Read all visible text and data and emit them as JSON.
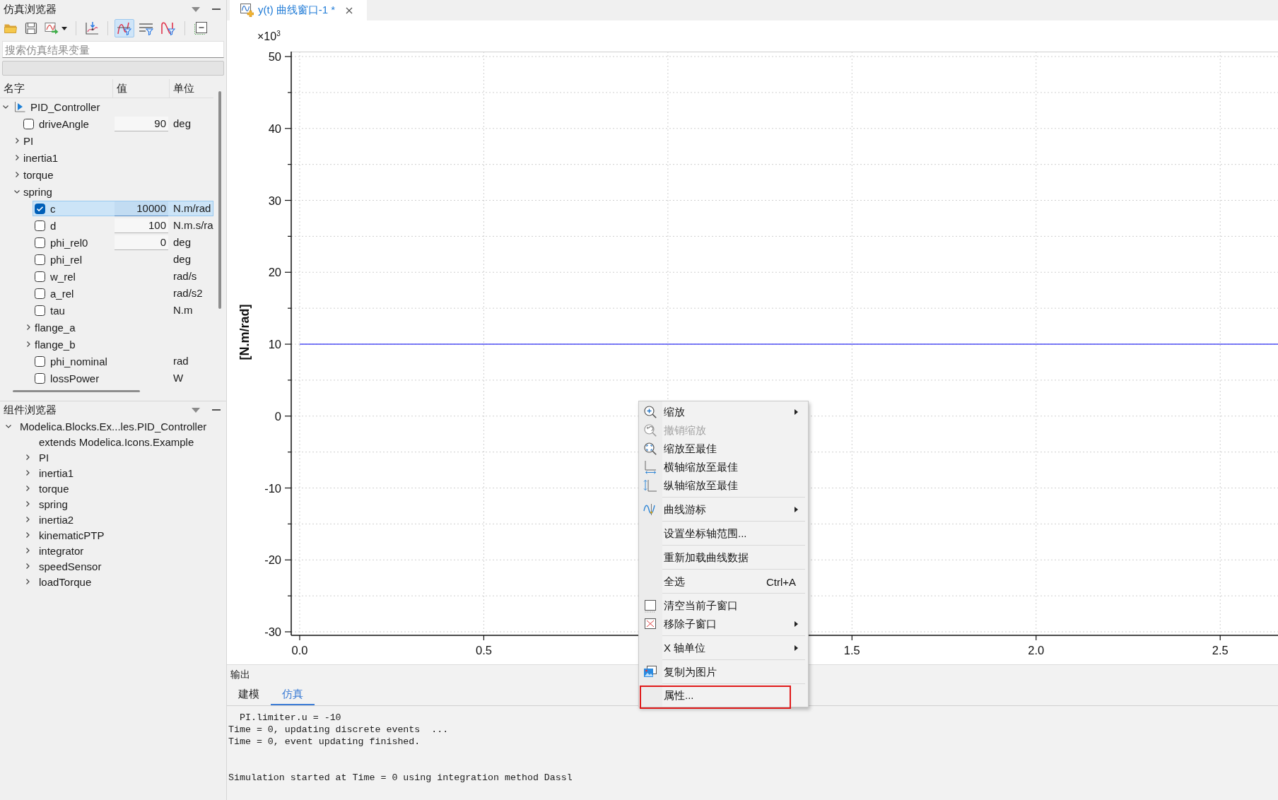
{
  "simulation_browser": {
    "title": "仿真浏览器",
    "toolbar": [
      [
        {
          "on": false
        },
        {
          "on": false
        },
        {
          "on": false
        }
      ],
      [
        {
          "on": false
        }
      ],
      [
        {
          "on": true
        },
        {
          "on": false
        },
        {
          "on": false
        }
      ],
      [
        {
          "on": false
        }
      ]
    ],
    "search": {
      "placeholder": "搜索仿真结果变量"
    },
    "columns": [
      "名字",
      "值",
      "单位"
    ],
    "tree": [
      {
        "kind": "model",
        "label": "PID_Controller",
        "expanded": true,
        "selected": false,
        "children": [
          {
            "kind": "parameter",
            "label": "driveAngle",
            "value": "90",
            "unit": "deg",
            "checked": false,
            "selected": false
          },
          {
            "kind": "group",
            "label": "PI",
            "expanded": false,
            "selected": false
          },
          {
            "kind": "group",
            "label": "inertia1",
            "expanded": false,
            "selected": false
          },
          {
            "kind": "group",
            "label": "torque",
            "expanded": false,
            "selected": false
          },
          {
            "kind": "group",
            "label": "spring",
            "expanded": true,
            "selected": false,
            "children": [
              {
                "kind": "parameter",
                "label": "c",
                "value": "10000",
                "unit": "N.m/rad",
                "checked": true,
                "selected": true
              },
              {
                "kind": "parameter",
                "label": "d",
                "value": "100",
                "unit": "N.m.s/ra",
                "checked": false,
                "selected": false
              },
              {
                "kind": "parameter",
                "label": "phi_rel0",
                "value": "0",
                "unit": "deg",
                "checked": false,
                "selected": false
              },
              {
                "kind": "variable",
                "label": "phi_rel",
                "unit": "deg",
                "checked": false,
                "selected": false
              },
              {
                "kind": "variable",
                "label": "w_rel",
                "unit": "rad/s",
                "checked": false,
                "selected": false
              },
              {
                "kind": "variable",
                "label": "a_rel",
                "unit": "rad/s2",
                "checked": false,
                "selected": false
              },
              {
                "kind": "variable",
                "label": "tau",
                "unit": "N.m",
                "checked": false,
                "selected": false
              },
              {
                "kind": "group",
                "label": "flange_a",
                "expanded": false,
                "selected": false
              },
              {
                "kind": "group",
                "label": "flange_b",
                "expanded": false,
                "selected": false
              },
              {
                "kind": "variable",
                "label": "phi_nominal",
                "unit": "rad",
                "checked": false,
                "selected": false
              },
              {
                "kind": "variable",
                "label": "lossPower",
                "unit": "W",
                "checked": false,
                "selected": false
              }
            ]
          }
        ]
      }
    ]
  },
  "component_browser": {
    "title": "组件浏览器",
    "tree": [
      {
        "kind": "model",
        "label": "Modelica.Blocks.Ex...les.PID_Controller",
        "expanded": true,
        "selected": false,
        "children": [
          {
            "kind": "extends",
            "label": "extends Modelica.Icons.Example",
            "selected": false
          },
          {
            "kind": "component",
            "label": "PI",
            "expanded": false,
            "selected": false
          },
          {
            "kind": "component",
            "label": "inertia1",
            "expanded": false,
            "selected": false
          },
          {
            "kind": "component",
            "label": "torque",
            "expanded": false,
            "selected": false
          },
          {
            "kind": "component",
            "label": "spring",
            "expanded": false,
            "selected": false
          },
          {
            "kind": "component",
            "label": "inertia2",
            "expanded": false,
            "selected": false
          },
          {
            "kind": "component",
            "label": "kinematicPTP",
            "expanded": false,
            "selected": false
          },
          {
            "kind": "component",
            "label": "integrator",
            "expanded": false,
            "selected": false
          },
          {
            "kind": "component",
            "label": "speedSensor",
            "expanded": false,
            "selected": false
          },
          {
            "kind": "component",
            "label": "loadTorque",
            "expanded": false,
            "selected": false
          }
        ]
      }
    ]
  },
  "document_tabs": [
    {
      "label": "y(t) 曲线窗口-1 *",
      "selected": true
    }
  ],
  "plot": {
    "scale_label": "×10$^{3}$",
    "chart_data": {
      "type": "line",
      "ylabel": "[N.m/rad]",
      "x": [
        0,
        2.657
      ],
      "series": [
        {
          "color": "#4f4ff5",
          "values": [
            10,
            10
          ]
        }
      ],
      "xlim": [
        -0.023,
        2.657
      ],
      "ylim": [
        -30.49,
        50.69
      ],
      "xticks": [
        {
          "value": 0,
          "label": "0.0"
        },
        {
          "value": 0.5,
          "label": "0.5"
        },
        {
          "value": 1.5,
          "label": "1.5"
        },
        {
          "value": 2,
          "label": "2.0"
        },
        {
          "value": 2.5,
          "label": "2.5"
        }
      ],
      "yticks": [
        50,
        40,
        30,
        20,
        10,
        0,
        -10,
        -20,
        -30
      ],
      "grid": true
    }
  },
  "output": {
    "title": "输出",
    "tabs": [
      {
        "label": "建模",
        "selected": false
      },
      {
        "label": "仿真",
        "selected": true
      }
    ],
    "log_blocks": [
      [
        "  PI.limiter.u = -10",
        "Time = 0, updating discrete events  ...",
        "Time = 0, event updating finished."
      ],
      [
        "Simulation started at Time = 0 using integration method Dassl"
      ]
    ]
  },
  "context_menu": {
    "sections": [
      [
        {
          "label": "缩放",
          "disabled": false,
          "submenu": true,
          "highlighted": false
        },
        {
          "label": "撤销缩放",
          "disabled": true,
          "submenu": false,
          "highlighted": false
        },
        {
          "label": "缩放至最佳",
          "disabled": false,
          "submenu": false,
          "highlighted": false
        },
        {
          "label": "横轴缩放至最佳",
          "disabled": false,
          "submenu": false,
          "highlighted": false
        },
        {
          "label": "纵轴缩放至最佳",
          "disabled": false,
          "submenu": false,
          "highlighted": false
        }
      ],
      [
        {
          "label": "曲线游标",
          "disabled": false,
          "submenu": true,
          "highlighted": false
        }
      ],
      [
        {
          "label": "设置坐标轴范围...",
          "disabled": false,
          "submenu": false,
          "highlighted": false
        }
      ],
      [
        {
          "label": "重新加载曲线数据",
          "disabled": false,
          "submenu": false,
          "highlighted": false
        }
      ],
      [
        {
          "label": "全选",
          "shortcut": "Ctrl+A",
          "disabled": false,
          "submenu": false,
          "highlighted": false
        }
      ],
      [
        {
          "label": "清空当前子窗口",
          "disabled": false,
          "submenu": false,
          "highlighted": false
        },
        {
          "label": "移除子窗口",
          "disabled": false,
          "submenu": true,
          "highlighted": false
        }
      ],
      [
        {
          "label": "X 轴单位",
          "disabled": false,
          "submenu": true,
          "highlighted": false
        }
      ],
      [
        {
          "label": "复制为图片",
          "disabled": false,
          "submenu": false,
          "highlighted": false
        }
      ],
      [
        {
          "label": "属性...",
          "disabled": false,
          "submenu": false,
          "highlighted": true
        }
      ]
    ]
  }
}
